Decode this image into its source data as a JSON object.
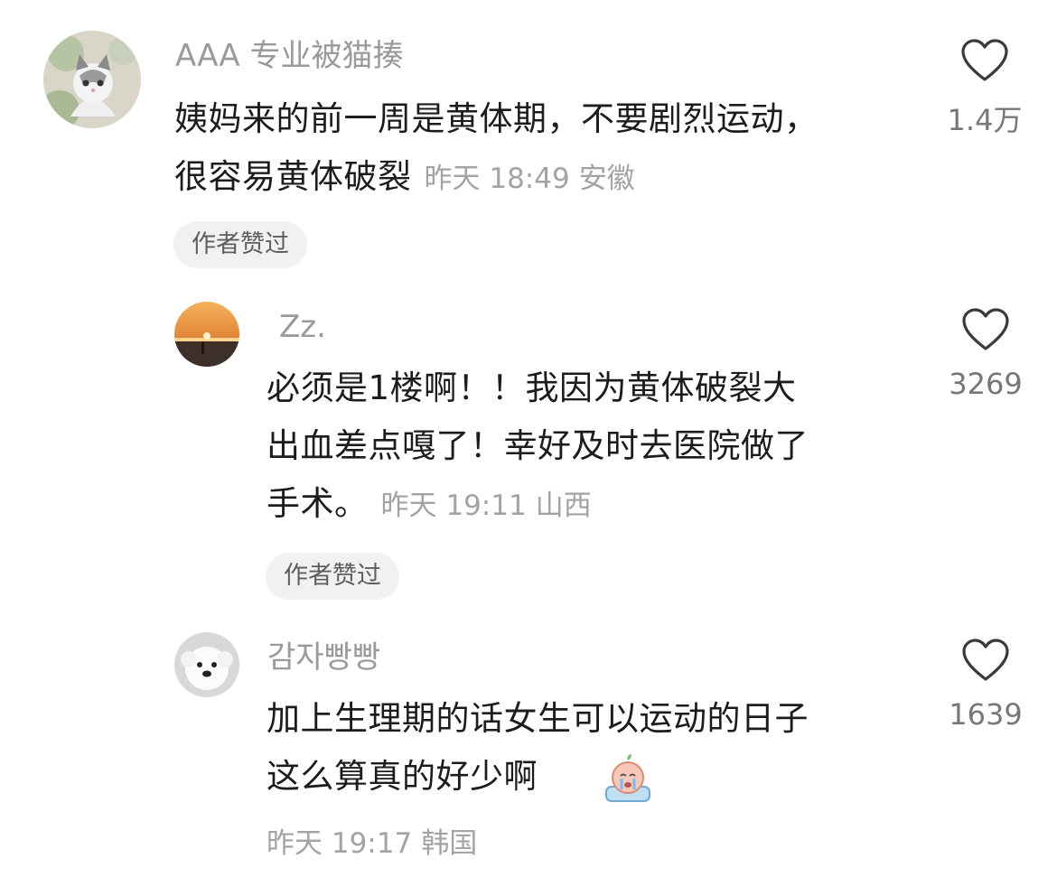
{
  "comments": [
    {
      "username": "AAA 专业被猫揍",
      "lines": [
        "姨妈来的前一周是黄体期，不要剧烈运动，",
        "很容易黄体破裂"
      ],
      "time": "昨天 18:49",
      "location": "安徽",
      "badge": "作者赞过",
      "likes": "1.4万",
      "avatar_icon": "cat-avatar-icon"
    },
    {
      "username": "Zz.",
      "lines": [
        "必须是1楼啊！！我因为黄体破裂大",
        "出血差点嘎了！幸好及时去医院做了",
        "手术。"
      ],
      "time": "昨天 19:11",
      "location": "山西",
      "badge": "作者赞过",
      "likes": "3269",
      "avatar_icon": "sunset-avatar-icon"
    },
    {
      "username": "감자빵빵",
      "lines": [
        "加上生理期的话女生可以运动的日子",
        "这么算真的好少啊"
      ],
      "time": "昨天 19:17",
      "location": "韩国",
      "likes": "1639",
      "avatar_icon": "dog-avatar-icon",
      "emoji": "crying-peach-emoji-icon"
    }
  ],
  "colors": {
    "username": "#9a9a9a",
    "meta": "#a3a3a3",
    "badge_bg": "#f1f1f1",
    "heart_stroke": "#3a3a3a"
  }
}
